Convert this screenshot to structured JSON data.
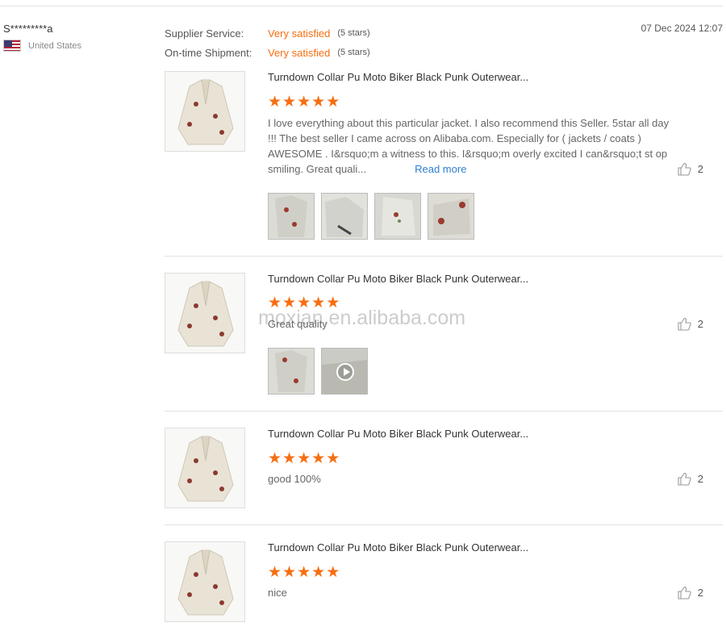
{
  "reviewer": {
    "name": "S*********a",
    "country": "United States",
    "flag_icon": "us-flag-icon"
  },
  "ratings": [
    {
      "label": "Supplier Service:",
      "value": "Very satisfied",
      "stars": "(5 stars)"
    },
    {
      "label": "On-time Shipment:",
      "value": "Very satisfied",
      "stars": "(5 stars)"
    }
  ],
  "date": "07 Dec 2024 12:07",
  "accent_color": "#f76e11",
  "link_color": "#2f7fd1",
  "reviews": [
    {
      "product_title": "Turndown Collar Pu Moto Biker Black Punk Outerwear...",
      "rating": 5,
      "text": "I love everything about this particular jacket. I also recommend this Seller. 5star all day !!! The best seller I came across on Alibaba.com. Especially for ( jackets / coats ) AWESOME . I&rsquo;m a witness to this. I&rsquo;m overly excited I can&rsquo;t st op smiling. Great quali...",
      "read_more": "Read more",
      "likes": "2",
      "photos": [
        "photo",
        "photo",
        "photo",
        "photo"
      ]
    },
    {
      "product_title": "Turndown Collar Pu Moto Biker Black Punk Outerwear...",
      "rating": 5,
      "text": "Great quality",
      "likes": "2",
      "photos": [
        "photo",
        "video"
      ]
    },
    {
      "product_title": "Turndown Collar Pu Moto Biker Black Punk Outerwear...",
      "rating": 5,
      "text": "good 100%",
      "likes": "2",
      "photos": []
    },
    {
      "product_title": "Turndown Collar Pu Moto Biker Black Punk Outerwear...",
      "rating": 5,
      "text": "nice",
      "likes": "2",
      "photos": []
    }
  ],
  "watermark": "moxian.en.alibaba.com"
}
